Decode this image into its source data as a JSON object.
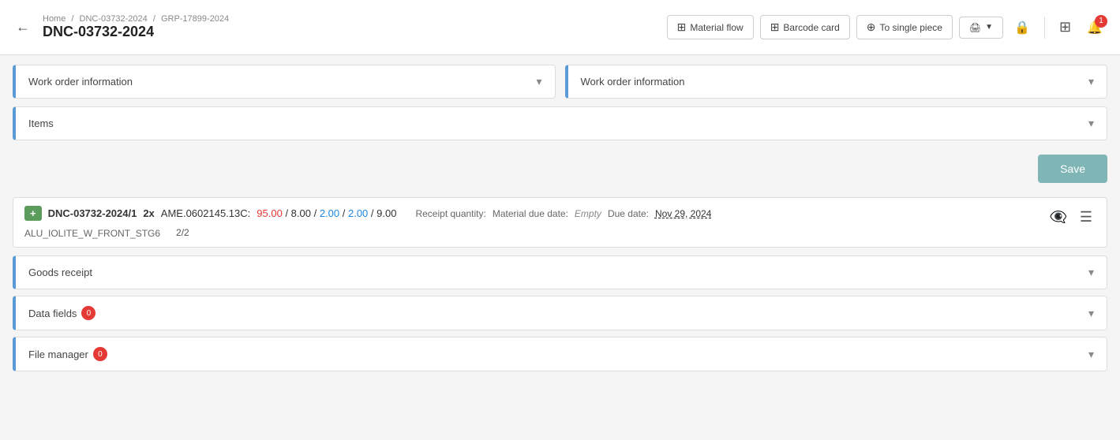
{
  "header": {
    "back_label": "←",
    "breadcrumb": {
      "home": "Home",
      "separator1": "/",
      "item1": "DNC-03732-2024",
      "separator2": "/",
      "item2": "GRP-17899-2024"
    },
    "title": "DNC-03732-2024",
    "nav_buttons": [
      {
        "id": "material-flow",
        "icon": "⊞",
        "label": "Material flow"
      },
      {
        "id": "barcode-card",
        "icon": "⊞",
        "label": "Barcode card"
      },
      {
        "id": "to-single-piece",
        "icon": "⊕",
        "label": "To single piece"
      }
    ],
    "print_icon": "🖨",
    "lock_icon": "🔒",
    "grid_icon": "⊞",
    "notification_count": "1"
  },
  "left_panel": {
    "title": "Work order information"
  },
  "right_panel": {
    "title": "Work order information"
  },
  "items_panel": {
    "title": "Items"
  },
  "save_button": "Save",
  "work_order": {
    "add_label": "+",
    "id": "DNC-03732-2024/1",
    "quantity_prefix": "2x",
    "code": "AME.0602145.13C:",
    "nums_red": "95.00",
    "nums_rest": "/ 8.00 /",
    "nums_blue": "2.00",
    "nums_blue2": "/ 2.00 /",
    "nums_black": "9.00",
    "sub_line": "ALU_IOLITE_W_FRONT_STG6",
    "receipt_label": "Receipt quantity:",
    "receipt_value": "2/2",
    "material_due_label": "Material due date:",
    "material_due_value": "Empty",
    "due_date_label": "Due date:",
    "due_date_value": "Nov 29, 2024"
  },
  "goods_receipt": {
    "title": "Goods receipt"
  },
  "data_fields": {
    "title": "Data fields",
    "badge": "0"
  },
  "file_manager": {
    "title": "File manager",
    "badge": "0"
  }
}
